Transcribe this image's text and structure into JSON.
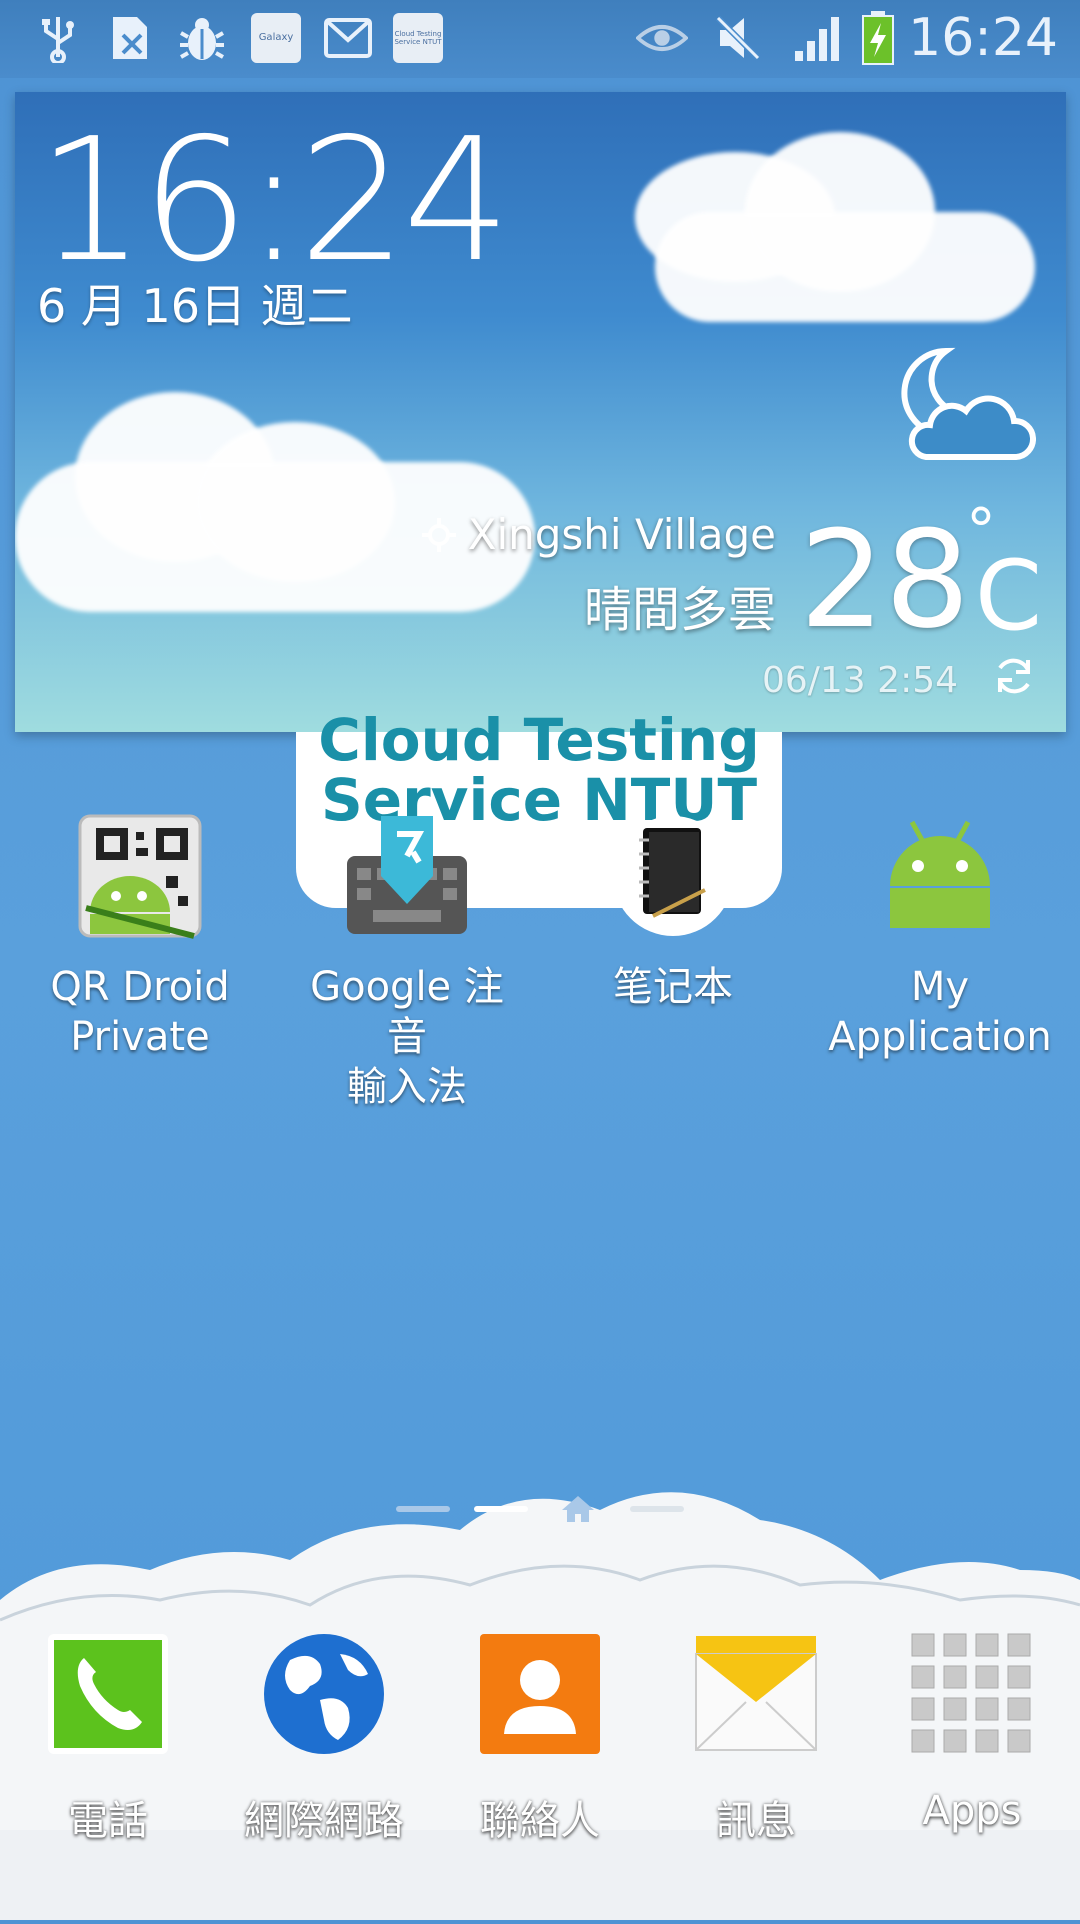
{
  "status_bar": {
    "time": "16:24",
    "left_icons": [
      "usb-icon",
      "sim-icon",
      "bug-icon",
      "galaxy-icon",
      "mail-icon",
      "cloud-testing-icon"
    ],
    "galaxy_label": "Galaxy",
    "cloud_testing_label": "Cloud Testing Service NTUT",
    "right_icons": [
      "eye-icon",
      "mute-icon",
      "signal-icon",
      "battery-icon"
    ]
  },
  "weather": {
    "time": "16:24",
    "date": "6 月 16日 週二",
    "location": "Xingshi Village",
    "condition": "晴間多雲",
    "temperature": "28",
    "degree": "°",
    "unit": "C",
    "updated": "06/13 2:54"
  },
  "cloud_widget": {
    "line1": "Cloud Testing",
    "line2": "Service NTUT"
  },
  "apps": [
    {
      "label": "QR Droid\nPrivate",
      "line1": "QR Droid",
      "line2": "Private"
    },
    {
      "label": "Google 注音輸入法",
      "line1": "Google 注音",
      "line2": "輸入法"
    },
    {
      "label": "笔记本",
      "line1": "笔记本",
      "line2": ""
    },
    {
      "label": "My Application",
      "line1": "My",
      "line2": "Application"
    }
  ],
  "pager": {
    "pages": 4,
    "current": 2,
    "home_index": 3
  },
  "dock": [
    {
      "label": "電話"
    },
    {
      "label": "網際網路"
    },
    {
      "label": "聯絡人"
    },
    {
      "label": "訊息"
    },
    {
      "label": "Apps"
    }
  ],
  "colors": {
    "wallpaper": "#4f98d8",
    "phone_green": "#5cc21d",
    "contacts_orange": "#f37b10",
    "accent_teal": "#1a90a8"
  }
}
